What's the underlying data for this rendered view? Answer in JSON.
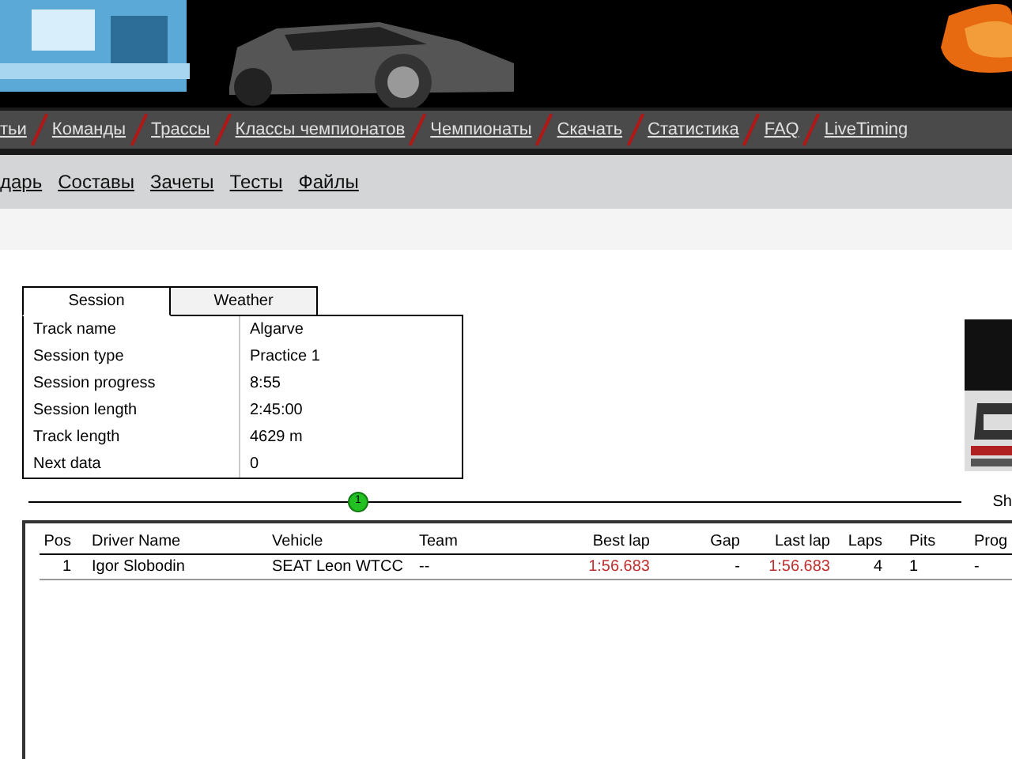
{
  "main_menu": [
    {
      "label": "тьи"
    },
    {
      "label": "Команды"
    },
    {
      "label": "Трассы"
    },
    {
      "label": "Классы чемпионатов"
    },
    {
      "label": "Чемпионаты"
    },
    {
      "label": "Скачать"
    },
    {
      "label": "Статистика"
    },
    {
      "label": "FAQ"
    },
    {
      "label": "LiveTiming"
    }
  ],
  "sub_menu": [
    {
      "label": "дарь"
    },
    {
      "label": "Составы"
    },
    {
      "label": "Зачеты"
    },
    {
      "label": "Тесты"
    },
    {
      "label": "Файлы"
    }
  ],
  "session_panel": {
    "tabs": [
      {
        "label": "Session",
        "selected": true
      },
      {
        "label": "Weather",
        "selected": false
      }
    ],
    "rows": [
      {
        "label": "Track name",
        "value": "Algarve"
      },
      {
        "label": "Session type",
        "value": "Practice 1"
      },
      {
        "label": "Session progress",
        "value": "8:55"
      },
      {
        "label": "Session length",
        "value": "2:45:00"
      },
      {
        "label": "Track length",
        "value": "4629 m"
      },
      {
        "label": "Next data",
        "value": "0"
      }
    ]
  },
  "divider_marker": "1",
  "side_label": "Sh",
  "results": {
    "columns": [
      "Pos",
      "Driver Name",
      "Vehicle",
      "Team",
      "Best lap",
      "Gap",
      "Last lap",
      "Laps",
      "Pits",
      "Prog"
    ],
    "rows": [
      [
        "1",
        "Igor Slobodin",
        "SEAT Leon WTCC",
        "--",
        "1:56.683",
        "-",
        "1:56.683",
        "4",
        "1",
        "-"
      ]
    ]
  }
}
